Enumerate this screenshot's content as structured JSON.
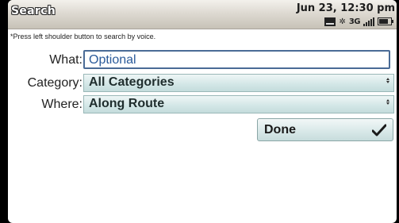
{
  "titlebar": {
    "app_title": "Search",
    "datetime": "Jun 23, 12:30 pm",
    "status_icons": [
      "message-icon",
      "bluetooth-icon",
      "network-3g-icon",
      "signal-icon",
      "battery-icon"
    ],
    "network_label": "3G"
  },
  "hint": "*Press left shoulder button to search by voice.",
  "form": {
    "what": {
      "label": "What:",
      "placeholder": "Optional"
    },
    "category": {
      "label": "Category:",
      "value": "All Categories"
    },
    "where": {
      "label": "Where:",
      "value": "Along Route"
    }
  },
  "done_button": {
    "label": "Done",
    "icon": "checkmark-icon"
  },
  "colors": {
    "input_border": "#4a6b96",
    "placeholder_text": "#2a5a9a",
    "select_fill": "#d2e6e6"
  }
}
